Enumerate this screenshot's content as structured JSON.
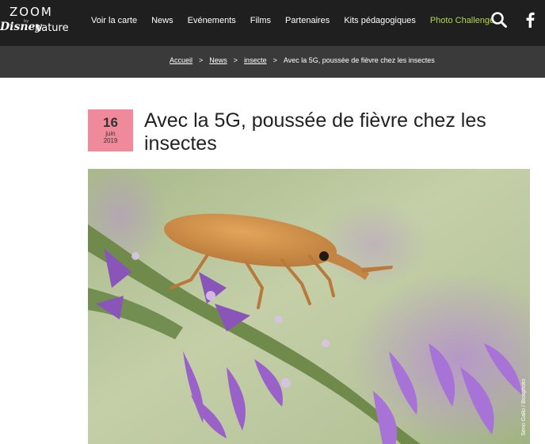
{
  "brand": {
    "zoom": "ZOOM",
    "by": "by",
    "disney": "Disney",
    "nature": "nature"
  },
  "nav": {
    "items": [
      {
        "label": "Voir la carte"
      },
      {
        "label": "News"
      },
      {
        "label": "Evénements"
      },
      {
        "label": "Films"
      },
      {
        "label": "Partenaires"
      },
      {
        "label": "Kits pédagogiques"
      },
      {
        "label": "Photo Challenge",
        "accent": true
      }
    ],
    "icons": {
      "search": "search-icon",
      "facebook": "facebook-icon"
    },
    "accent_color": "#b7d54a"
  },
  "breadcrumb": {
    "items": [
      "Accueil",
      "News",
      "insecte"
    ],
    "current": "Avec la 5G, poussée de fièvre chez les insectes",
    "separator": ">"
  },
  "article": {
    "date": {
      "day": "16",
      "month": "juin",
      "year": "2019"
    },
    "date_color": "#f08a9b",
    "title": "Avec la 5G, poussée de fièvre chez les insectes",
    "image_credit": "Serio Gallo / Biosphoto"
  }
}
